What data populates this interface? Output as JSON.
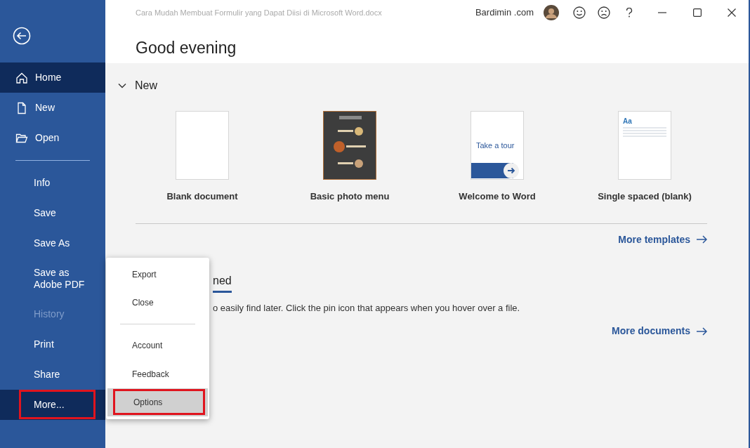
{
  "title_bar": {
    "document_title": "Cara Mudah Membuat Formulir yang Dapat Diisi di Microsoft Word.docx",
    "account_name": "Bardimin .com"
  },
  "sidebar": {
    "items": [
      {
        "label": "Home",
        "kind": "home",
        "selected": true,
        "disabled": false,
        "highlighted": false
      },
      {
        "label": "New",
        "kind": "new",
        "selected": false,
        "disabled": false,
        "highlighted": false
      },
      {
        "label": "Open",
        "kind": "open",
        "selected": false,
        "disabled": false,
        "highlighted": false
      },
      {
        "kind": "divider"
      },
      {
        "label": "Info",
        "kind": "plain",
        "selected": false,
        "disabled": false,
        "highlighted": false
      },
      {
        "label": "Save",
        "kind": "plain",
        "selected": false,
        "disabled": false,
        "highlighted": false
      },
      {
        "label": "Save As",
        "kind": "plain",
        "selected": false,
        "disabled": false,
        "highlighted": false
      },
      {
        "label": "Save as Adobe PDF",
        "kind": "plain",
        "selected": false,
        "disabled": false,
        "highlighted": false
      },
      {
        "label": "History",
        "kind": "plain",
        "selected": false,
        "disabled": true,
        "highlighted": false
      },
      {
        "label": "Print",
        "kind": "plain",
        "selected": false,
        "disabled": false,
        "highlighted": false
      },
      {
        "label": "Share",
        "kind": "plain",
        "selected": false,
        "disabled": false,
        "highlighted": false
      },
      {
        "label": "More...",
        "kind": "plain",
        "selected": true,
        "disabled": false,
        "highlighted": true
      }
    ]
  },
  "greeting": "Good evening",
  "new_section": {
    "heading": "New",
    "expanded": true,
    "templates": [
      {
        "label": "Blank document",
        "kind": "blank"
      },
      {
        "label": "Basic photo menu",
        "kind": "picture"
      },
      {
        "label": "Welcome to Word",
        "kind": "tour",
        "thumbnail_text": "Take a tour"
      },
      {
        "label": "Single spaced (blank)",
        "kind": "lines",
        "thumbnail_text": "Aa"
      }
    ],
    "more_link": "More templates"
  },
  "pinned_section": {
    "tab": "ned",
    "hint": "o easily find later. Click the pin icon that appears when you hover over a file.",
    "more_link": "More documents"
  },
  "more_menu": {
    "items": [
      {
        "label": "Export",
        "kind": "item",
        "selected": false,
        "highlighted": false
      },
      {
        "label": "Close",
        "kind": "item",
        "selected": false,
        "highlighted": false
      },
      {
        "kind": "divider"
      },
      {
        "label": "Account",
        "kind": "item",
        "selected": false,
        "highlighted": false
      },
      {
        "label": "Feedback",
        "kind": "item",
        "selected": false,
        "highlighted": false
      },
      {
        "label": "Options",
        "kind": "item",
        "selected": true,
        "highlighted": true
      }
    ]
  }
}
